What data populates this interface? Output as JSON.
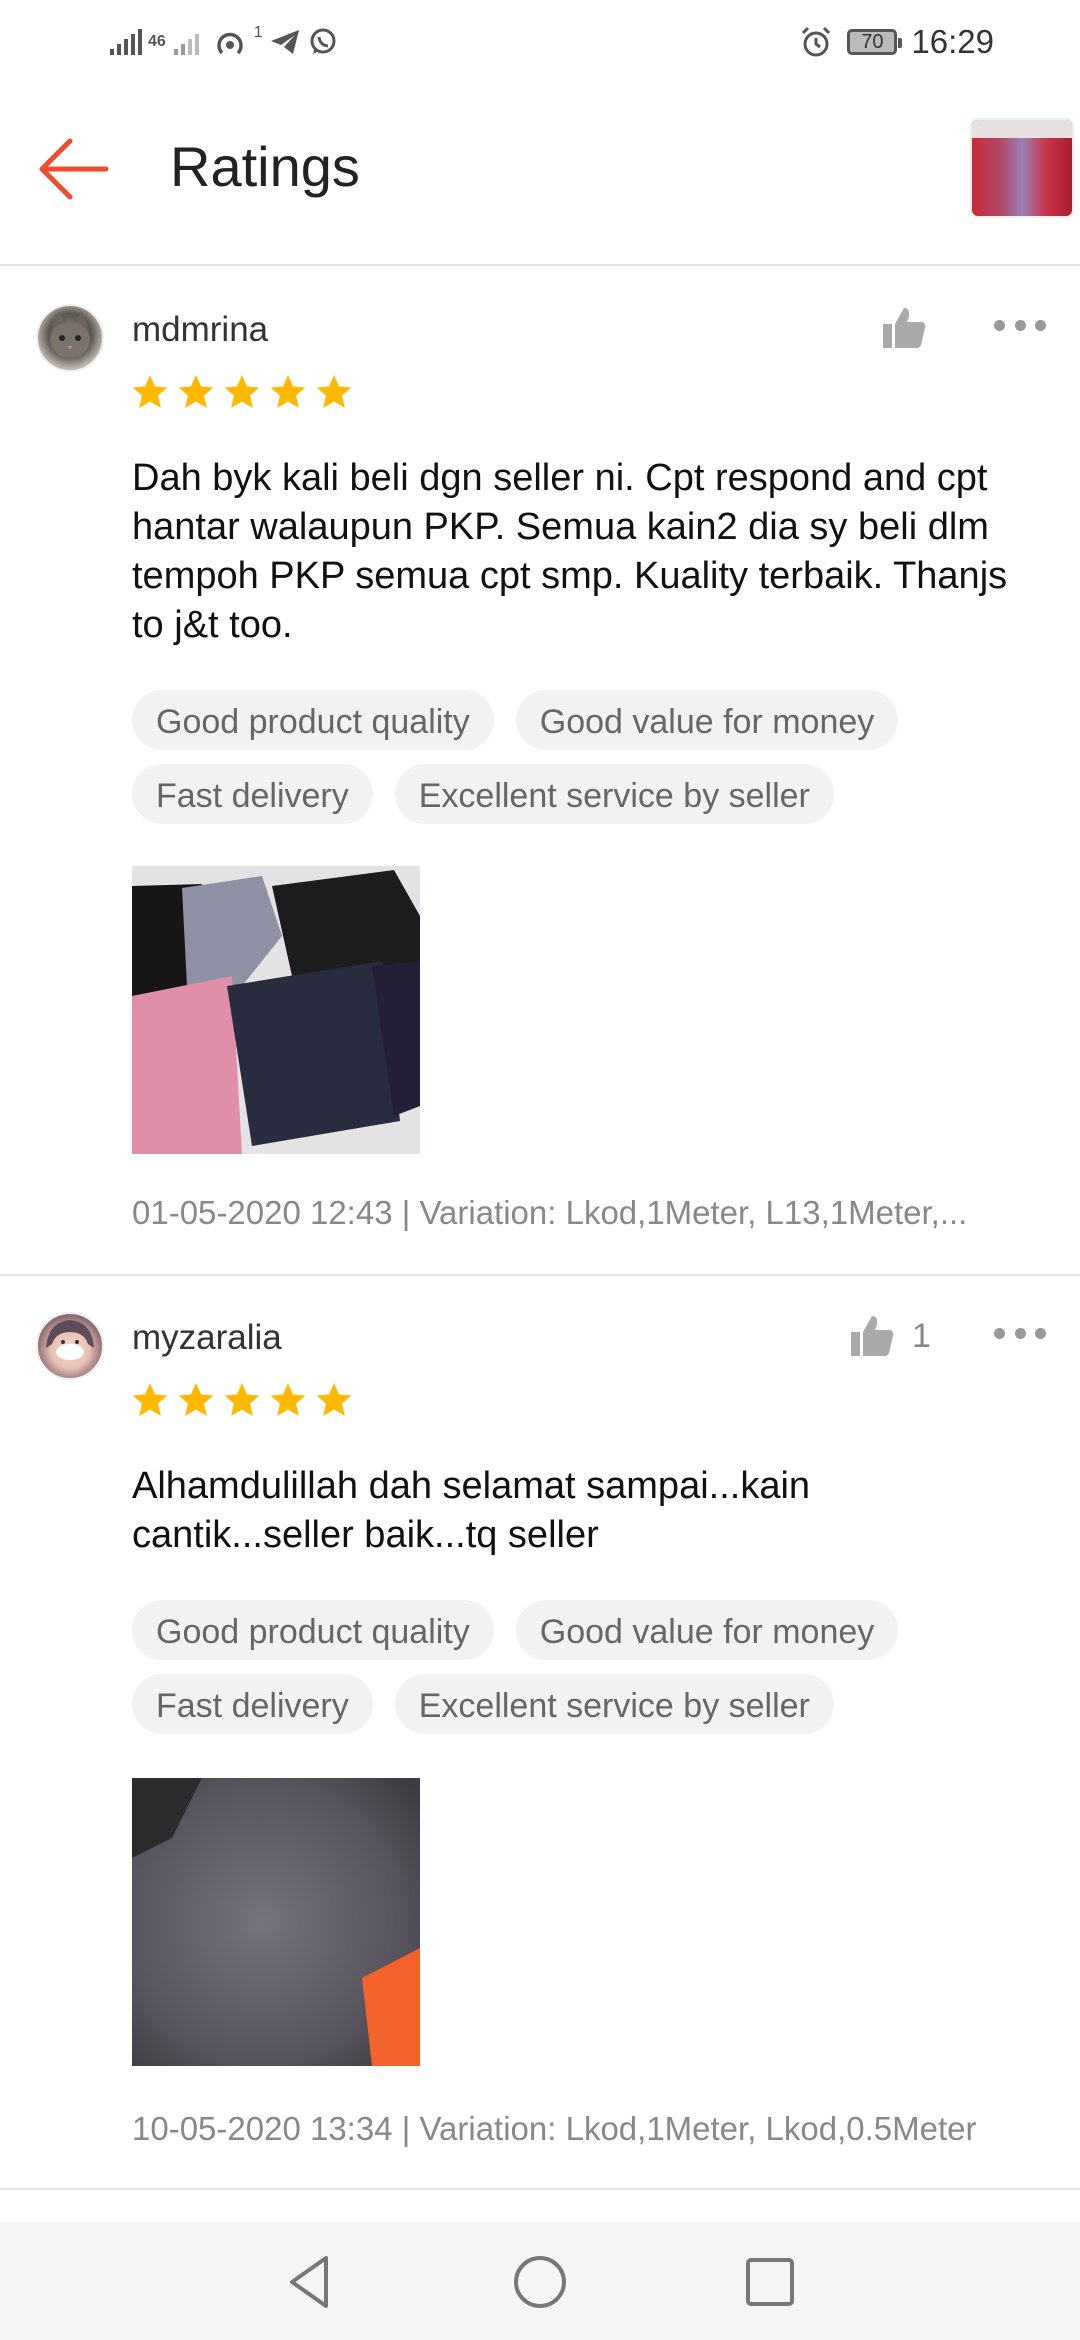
{
  "status_bar": {
    "network": "46",
    "notif_count": "1",
    "battery": "70",
    "time": "16:29"
  },
  "header": {
    "title": "Ratings"
  },
  "colors": {
    "accent": "#ee4d2d",
    "star": "#ffb800"
  },
  "reviews": [
    {
      "username": "mdmrina",
      "likes": "",
      "stars": 5,
      "comment": "Dah byk kali beli dgn seller ni. Cpt respond and cpt hantar walaupun PKP. Semua kain2 dia sy beli dlm tempoh PKP semua cpt smp. Kuality terbaik. Thanjs to j&t too.",
      "tags": [
        "Good product quality",
        "Good value for money",
        "Fast delivery",
        "Excellent service by seller"
      ],
      "meta": "01-05-2020 12:43 | Variation: Lkod,1Meter, L13,1Meter,..."
    },
    {
      "username": "myzaralia",
      "likes": "1",
      "stars": 5,
      "comment": "Alhamdulillah dah selamat sampai...kain cantik...seller baik...tq seller",
      "tags": [
        "Good product quality",
        "Good value for money",
        "Fast delivery",
        "Excellent service by seller"
      ],
      "meta": "10-05-2020 13:34 | Variation: Lkod,1Meter, Lkod,0.5Meter"
    }
  ]
}
